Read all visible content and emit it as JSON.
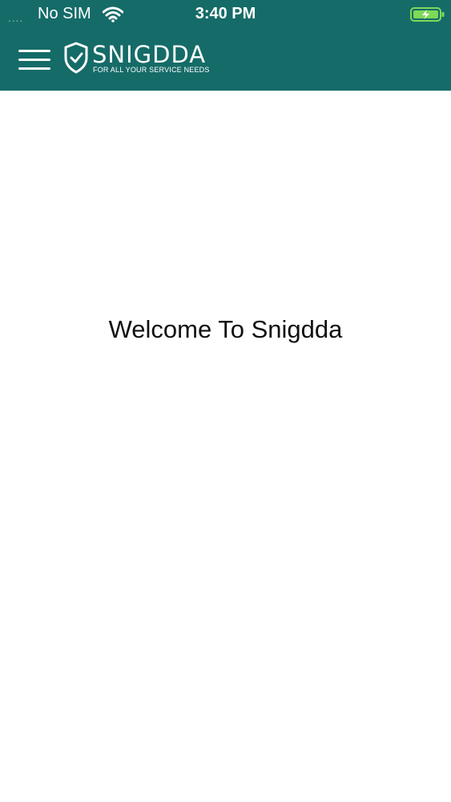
{
  "status_bar": {
    "signal": "....",
    "carrier": "No SIM",
    "time": "3:40 PM",
    "wifi_icon": "wifi-icon",
    "battery_icon": "battery-charging-icon",
    "battery_color": "#7ed957"
  },
  "header": {
    "menu_icon": "hamburger-menu-icon",
    "logo": {
      "icon": "shield-check-icon",
      "name": "SNIGDDA",
      "tagline": "FOR ALL YOUR SERVICE NEEDS"
    },
    "background_color": "#156b68"
  },
  "main": {
    "welcome_text": "Welcome To Snigdda"
  }
}
